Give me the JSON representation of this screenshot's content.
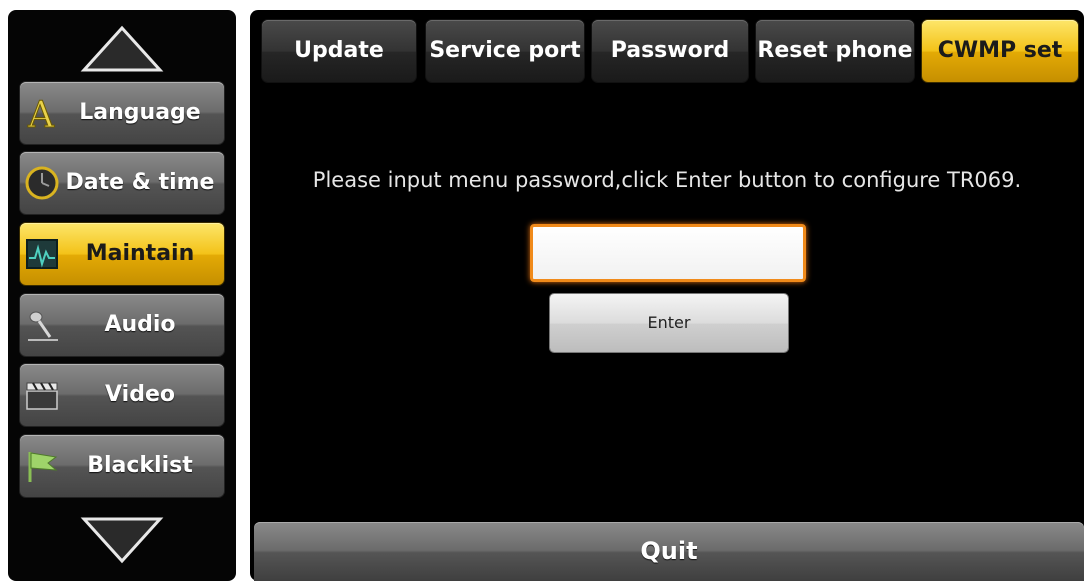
{
  "sidebar": {
    "items": [
      {
        "label": "Language",
        "icon": "language-icon",
        "active": false
      },
      {
        "label": "Date & time",
        "icon": "clock-icon",
        "active": false
      },
      {
        "label": "Maintain",
        "icon": "maintain-icon",
        "active": true
      },
      {
        "label": "Audio",
        "icon": "microphone-icon",
        "active": false
      },
      {
        "label": "Video",
        "icon": "clapperboard-icon",
        "active": false
      },
      {
        "label": "Blacklist",
        "icon": "blacklist-flag-icon",
        "active": false
      }
    ]
  },
  "tabs": [
    {
      "label": "Update",
      "active": false
    },
    {
      "label": "Service port",
      "active": false
    },
    {
      "label": "Password",
      "active": false
    },
    {
      "label": "Reset phone",
      "active": false
    },
    {
      "label": "CWMP set",
      "active": true
    }
  ],
  "main": {
    "message": "Please input menu password,click Enter button to configure TR069.",
    "password_value": "",
    "enter_label": "Enter",
    "quit_label": "Quit"
  },
  "colors": {
    "accent": "#f3c218",
    "input_border": "#f08a1a",
    "background": "#000000"
  }
}
